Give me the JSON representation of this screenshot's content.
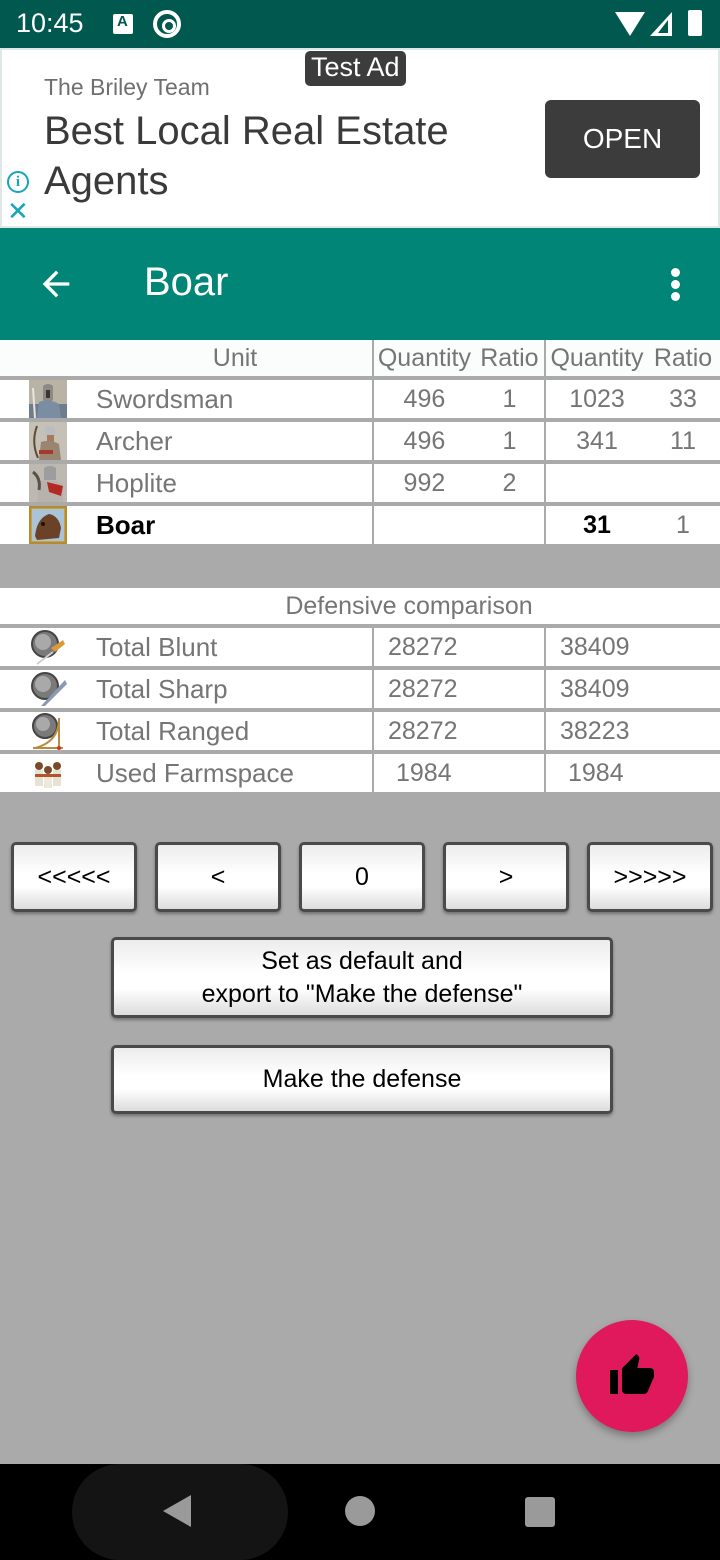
{
  "status_bar": {
    "time": "10:45",
    "icons": [
      "keyboard-a-icon",
      "data-saver-icon",
      "wifi-icon",
      "signal-icon",
      "battery-icon"
    ]
  },
  "ad": {
    "badge": "Test Ad",
    "advertiser": "The Briley Team",
    "headline": "Best Local Real Estate Agents",
    "cta": "OPEN",
    "info_icon": "i",
    "close_icon": "✕"
  },
  "app_bar": {
    "title": "Boar",
    "back_icon": "arrow-left",
    "menu_icon": "more-vert",
    "color": "#008577"
  },
  "unit_table": {
    "headers": {
      "unit": "Unit",
      "quantity_a": "Quantity",
      "ratio_a": "Ratio",
      "quantity_b": "Quantity",
      "ratio_b": "Ratio"
    },
    "rows": [
      {
        "name": "Swordsman",
        "qty_a": "496",
        "ratio_a": "1",
        "qty_b": "1023",
        "ratio_b": "33",
        "highlight": false
      },
      {
        "name": "Archer",
        "qty_a": "496",
        "ratio_a": "1",
        "qty_b": "341",
        "ratio_b": "11",
        "highlight": false
      },
      {
        "name": "Hoplite",
        "qty_a": "992",
        "ratio_a": "2",
        "qty_b": "",
        "ratio_b": "",
        "highlight": false
      },
      {
        "name": "Boar",
        "qty_a": "",
        "ratio_a": "",
        "qty_b": "31",
        "ratio_b": "1",
        "highlight": true
      }
    ]
  },
  "defense_table": {
    "title": "Defensive comparison",
    "rows": [
      {
        "label": "Total Blunt",
        "value_a": "28272",
        "value_b": "38409",
        "icon": "blunt-defense-icon"
      },
      {
        "label": "Total Sharp",
        "value_a": "28272",
        "value_b": "38409",
        "icon": "sharp-defense-icon"
      },
      {
        "label": "Total Ranged",
        "value_a": "28272",
        "value_b": "38223",
        "icon": "ranged-defense-icon"
      },
      {
        "label": "Used Farmspace",
        "value_a": "1984",
        "value_b": "1984",
        "icon": "farmspace-icon"
      }
    ]
  },
  "navigation": {
    "first": "<<<<<",
    "prev": "<",
    "current": "0",
    "next": ">",
    "last": ">>>>>"
  },
  "actions": {
    "set_default_line1": "Set as default and",
    "set_default_line2": "export to \"Make the defense\"",
    "make_defense": "Make the defense"
  },
  "fab": {
    "icon": "thumb-up",
    "color": "#e0195d"
  }
}
